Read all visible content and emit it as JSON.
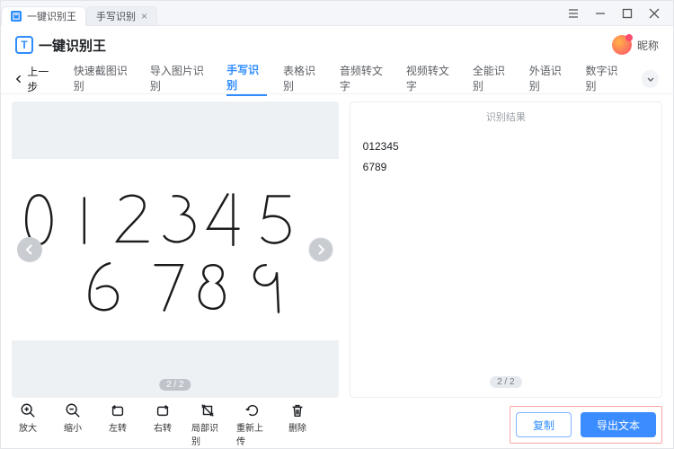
{
  "titlebar": {
    "tabs": [
      {
        "label": "一键识别王"
      },
      {
        "label": "手写识别"
      }
    ]
  },
  "header": {
    "app_name": "一键识别王",
    "nickname": "昵称"
  },
  "nav": {
    "back": "上一步",
    "items": [
      "快速截图识别",
      "导入图片识别",
      "手写识别",
      "表格识别",
      "音频转文字",
      "视频转文字",
      "全能识别",
      "外语识别",
      "数字识别"
    ],
    "active_index": 2
  },
  "left_pane": {
    "page_indicator": "2 / 2"
  },
  "right_pane": {
    "title": "识别结果",
    "lines": "012345\n6789",
    "page_indicator": "2 / 2"
  },
  "tools": [
    {
      "key": "zoom-in",
      "label": "放大"
    },
    {
      "key": "zoom-out",
      "label": "缩小"
    },
    {
      "key": "rotate-left",
      "label": "左转"
    },
    {
      "key": "rotate-right",
      "label": "右转"
    },
    {
      "key": "partial",
      "label": "局部识别"
    },
    {
      "key": "reupload",
      "label": "重新上传"
    },
    {
      "key": "delete",
      "label": "删除"
    }
  ],
  "actions": {
    "copy": "复制",
    "export": "导出文本"
  }
}
